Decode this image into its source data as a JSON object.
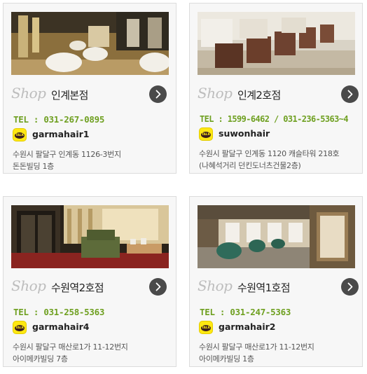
{
  "shop_word": "Shop",
  "stores": [
    {
      "name": "인계본점",
      "tel": "TEL : 031-267-0895",
      "kakao_id": "garmahair1",
      "address_line1": "수원시 팔달구 인계동 1126-3번지",
      "address_line2": "돈돈빌딩 1층"
    },
    {
      "name": "인계2호점",
      "tel": "TEL : 1599-6462 / 031-236-5363~4",
      "kakao_id": "suwonhair",
      "address_line1": "수원시 팔달구 인계동 1120 캐슬타워 218호",
      "address_line2": "(나혜석거리 던킨도너츠건물2층)"
    },
    {
      "name": "수원역2호점",
      "tel": "TEL : 031-258-5363",
      "kakao_id": "garmahair4",
      "address_line1": "수원시 팔달구 매산로1가 11-12번지",
      "address_line2": "아이메카빌딩 7층"
    },
    {
      "name": "수원역1호점",
      "tel": "TEL : 031-247-5363",
      "kakao_id": "garmahair2",
      "address_line1": "수원시 팔달구 매산로1가 11-12번지",
      "address_line2": "아이메카빌딩 1층"
    }
  ],
  "kakao_badge": "TALK",
  "icons": {
    "arrow": "chevron-right-icon",
    "kakao": "kakaotalk-icon"
  },
  "colors": {
    "tel": "#6fa021",
    "arrow_button": "#4a4a4a",
    "kakao_yellow": "#ffe812"
  }
}
